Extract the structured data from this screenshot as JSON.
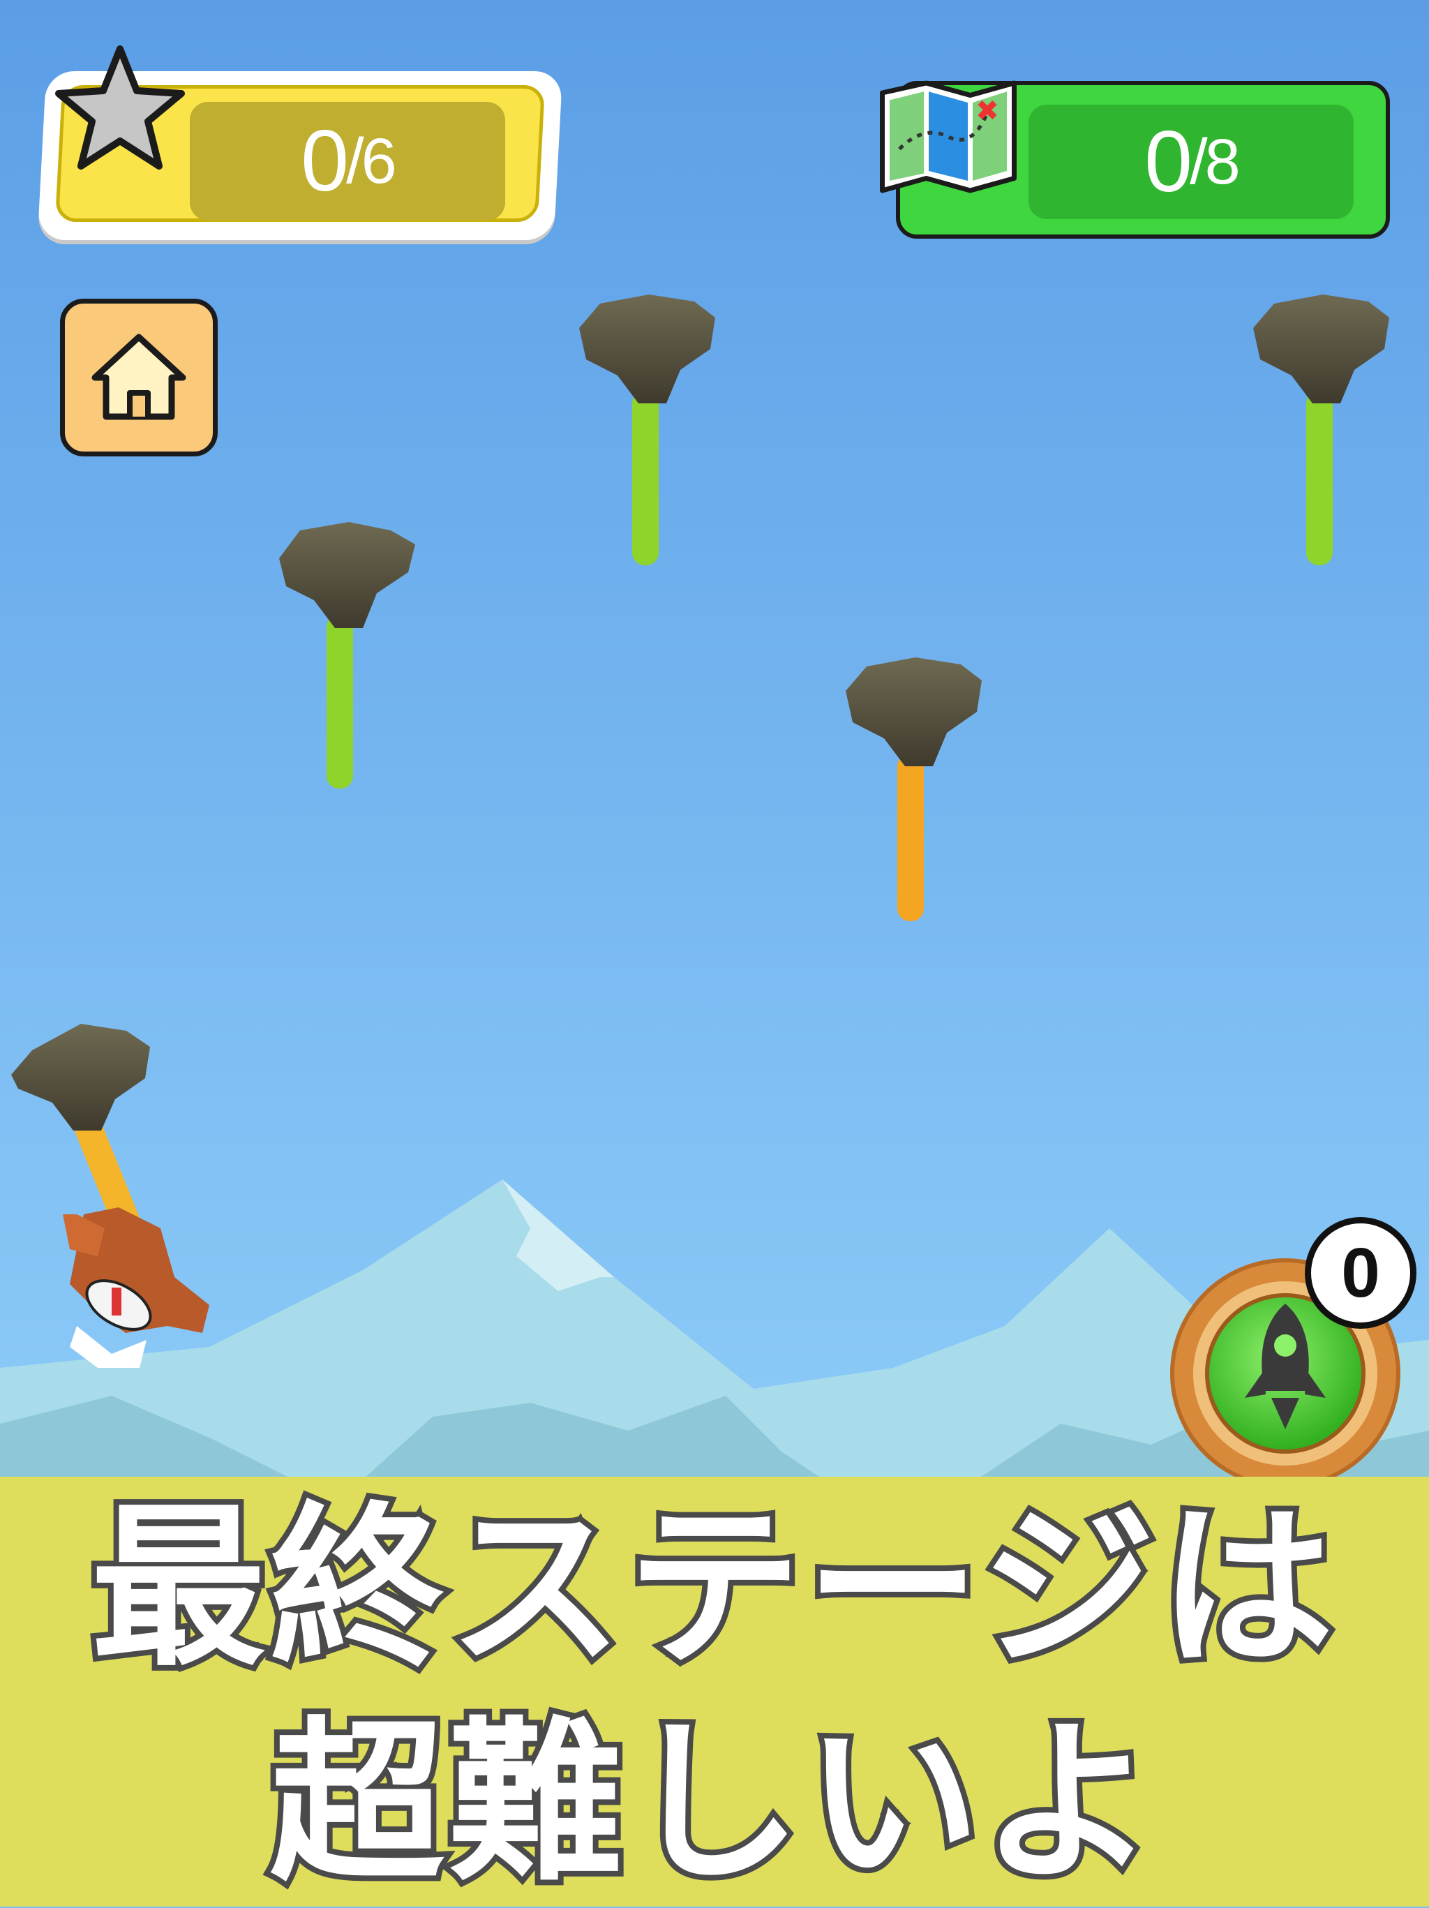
{
  "hud": {
    "stars": {
      "current": "0",
      "total": "/6"
    },
    "maps": {
      "current": "0",
      "total": "/8"
    }
  },
  "home_button": {
    "icon": "house-icon"
  },
  "rocket_button": {
    "icon": "rocket-icon",
    "count": "0"
  },
  "ropes": [
    {
      "name": "rock-rope-1",
      "color": "#8fd42a"
    },
    {
      "name": "rock-rope-2",
      "color": "#8fd42a"
    },
    {
      "name": "rock-rope-3",
      "color": "#8fd42a"
    },
    {
      "name": "rock-rope-4",
      "color": "#f4a623"
    },
    {
      "name": "rock-rope-5",
      "color": "#f4b52a"
    }
  ],
  "banner": {
    "line1": "最終ステージは",
    "line2": "超難しいよ",
    "background": "#dede5c"
  },
  "colors": {
    "sky_top": "#5b9ee6",
    "sky_bottom": "#8ccbf8",
    "mountain": "#a9dcea",
    "mountain_shade": "#8ec8d8"
  }
}
